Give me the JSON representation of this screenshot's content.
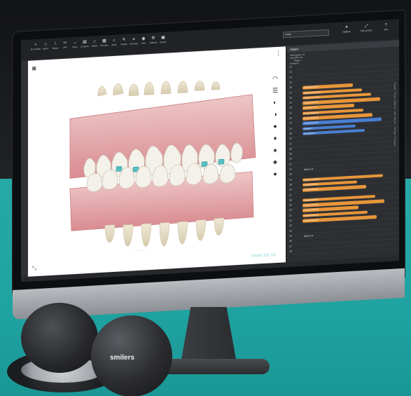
{
  "toolbar": {
    "items": [
      {
        "icon": "plus-icon",
        "label": "3D Toolbar"
      },
      {
        "icon": "tooth-icon",
        "label": "Attach"
      },
      {
        "icon": "bracket-icon",
        "label": "Stages"
      },
      {
        "icon": "cut-icon",
        "label": "IPR"
      },
      {
        "icon": "arrow-icon",
        "label": "Move"
      },
      {
        "icon": "ruler-icon",
        "label": "Contacts"
      },
      {
        "icon": "tooth-icon",
        "label": "Bolton"
      },
      {
        "icon": "grid-icon",
        "label": "Records"
      },
      {
        "icon": "tooth-icon",
        "label": "Smile"
      },
      {
        "icon": "pencil-icon",
        "label": "Toolbar"
      },
      {
        "icon": "layers-icon",
        "label": "Overlays"
      },
      {
        "icon": "eye-icon",
        "label": "View"
      },
      {
        "icon": "settings-icon",
        "label": "Artifacts"
      },
      {
        "icon": "report-icon",
        "label": "Report"
      }
    ],
    "setup_value": "setup",
    "right": [
      {
        "icon": "wrench-icon",
        "label": "Options"
      },
      {
        "icon": "fullscreen-icon",
        "label": "Full screen"
      },
      {
        "icon": "help-icon",
        "label": "Aid"
      }
    ]
  },
  "viewport": {
    "smile_label": "Smile Set Up"
  },
  "stages": {
    "title": "Stages",
    "header_lines": [
      "Total stages: 23",
      "Total IPR: 0.8"
    ],
    "columns": [
      "Stages",
      "Retainers"
    ],
    "row_numbers": [
      "12",
      "13",
      "14",
      "15",
      "16",
      "17",
      "18",
      "19",
      "20",
      "21",
      "22",
      "23",
      "24",
      "25",
      "26",
      "27",
      "28",
      "29",
      "30",
      "31",
      "32",
      "33",
      "34",
      "35",
      "36",
      "37",
      "38",
      "39",
      "40",
      "41",
      "42",
      "43",
      "44",
      "45",
      "46",
      "47",
      "48"
    ],
    "bars": [
      {
        "row": 4,
        "label": "Tipping (0.97°/E)",
        "color": "#e8963a"
      },
      {
        "row": 5,
        "label": "Distalizacion (0.03)",
        "color": "#e8963a"
      },
      {
        "row": 6,
        "label": "Rotation 1° 0.2°/S",
        "color": "#e8963a"
      },
      {
        "row": 7,
        "label": "Torque (0.16°/S)",
        "color": "#e8963a"
      },
      {
        "row": 8,
        "label": "Torque (0.7°/S)",
        "color": "#e8963a"
      },
      {
        "row": 9,
        "label": "Torque (0.38°/S)",
        "color": "#e8963a"
      },
      {
        "row": 10,
        "label": "Torque (0.38°/S)",
        "color": "#e8963a"
      },
      {
        "row": 11,
        "label": "Torque (0.33°/S)",
        "color": "#4a7fd1"
      },
      {
        "row": 12,
        "label": "Rotation ↑",
        "color": "#4a7fd1"
      },
      {
        "row": 13,
        "label": "Distalizacion ↓",
        "color": "#4a7fd1"
      },
      {
        "row": 20,
        "label": "Button Cut",
        "color": "#2e3034"
      },
      {
        "row": 22,
        "label": "Rotation (1.58°/S)",
        "color": "#e8963a"
      },
      {
        "row": 23,
        "label": "Torque (0.06°/S)",
        "color": "#e8963a"
      },
      {
        "row": 24,
        "label": "Torque (0.81°/S)",
        "color": "#e8963a"
      },
      {
        "row": 26,
        "label": "Tipping (0.05°/S)",
        "color": "#e8963a"
      },
      {
        "row": 27,
        "label": "Torque (0.03°/S)",
        "color": "#e8963a"
      },
      {
        "row": 28,
        "label": "Torque (0.08°/S)",
        "color": "#e8963a"
      },
      {
        "row": 29,
        "label": "Torque (0.80°/S)",
        "color": "#e8963a"
      },
      {
        "row": 30,
        "label": "Torque (0.38°/S)",
        "color": "#e8963a"
      },
      {
        "row": 33,
        "label": "Button Cut",
        "color": "#2e3034"
      }
    ],
    "vertical_text": "Stages · Steps · Aligners · Add Stages · Change of Stages"
  },
  "product": {
    "brand": "smilers"
  }
}
